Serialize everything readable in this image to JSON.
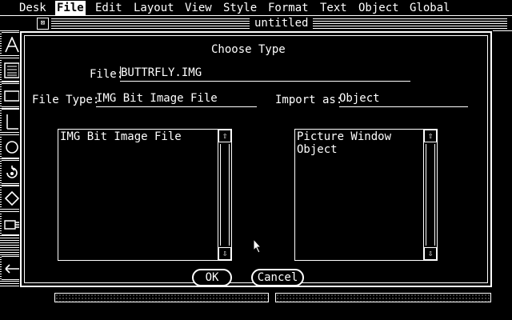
{
  "menu": {
    "items": [
      {
        "label": "Desk"
      },
      {
        "label": "File"
      },
      {
        "label": "Edit"
      },
      {
        "label": "Layout"
      },
      {
        "label": "View"
      },
      {
        "label": "Style"
      },
      {
        "label": "Format"
      },
      {
        "label": "Text"
      },
      {
        "label": "Object"
      },
      {
        "label": "Global"
      }
    ],
    "selected": "File"
  },
  "window": {
    "title": "untitled",
    "close_glyph": "⊠"
  },
  "tools": [
    {
      "icon": "text-tool-icon"
    },
    {
      "icon": "picture-frame-tool-icon"
    },
    {
      "icon": "rectangle-tool-icon"
    },
    {
      "icon": "line-tool-icon"
    },
    {
      "icon": "ellipse-tool-icon"
    },
    {
      "icon": "rotate-tool-icon"
    },
    {
      "icon": "polygon-tool-icon"
    },
    {
      "icon": "hand-tool-icon"
    },
    {
      "icon": "arrow-left-icon"
    }
  ],
  "dialog": {
    "title": "Choose Type",
    "file_label": "File:",
    "file_value": "BUTTRFLY.IMG",
    "file_type_label": "File Type:",
    "file_type_value": "IMG Bit Image File",
    "import_label": "Import as:",
    "import_value": "Object",
    "left_list": [
      "IMG Bit Image File"
    ],
    "right_list": [
      "Picture Window",
      "Object"
    ],
    "scroll_up_glyph": "⇧",
    "scroll_down_glyph": "⇩",
    "ok_label": "OK",
    "cancel_label": "Cancel"
  }
}
